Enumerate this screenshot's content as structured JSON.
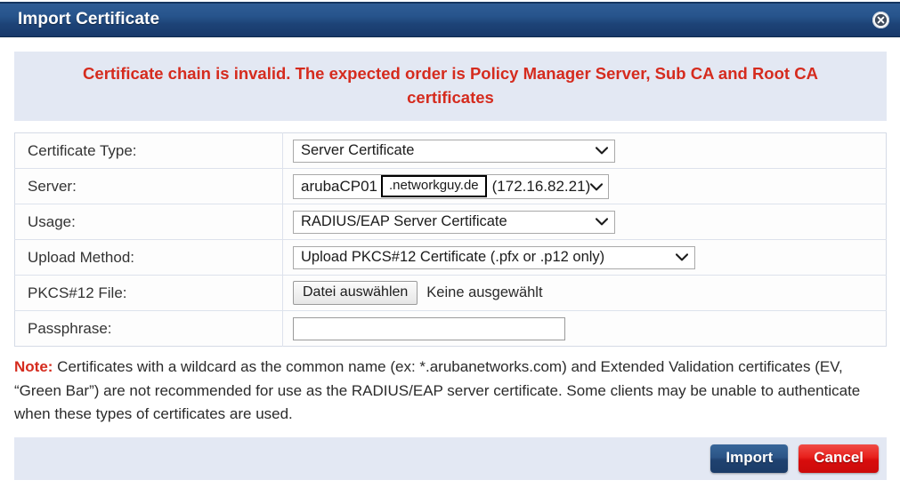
{
  "window": {
    "title": "Import Certificate",
    "close_icon": "close-circle-icon"
  },
  "error": {
    "message": "Certificate chain is invalid. The expected order is Policy Manager Server, Sub CA and Root CA certificates",
    "color": "#d52b1e",
    "background": "#e3e8f3"
  },
  "form": {
    "rows": [
      {
        "label": "Certificate Type:",
        "control": "select",
        "value": "Server Certificate"
      },
      {
        "label": "Server:",
        "control": "server-select",
        "host": "arubaCP01",
        "domain": ".networkguy.de",
        "ip": "(172.16.82.21)"
      },
      {
        "label": "Usage:",
        "control": "select",
        "value": "RADIUS/EAP Server Certificate"
      },
      {
        "label": "Upload Method:",
        "control": "select",
        "value": "Upload PKCS#12 Certificate (.pfx or .p12 only)"
      },
      {
        "label": "PKCS#12 File:",
        "control": "file",
        "button_label": "Datei auswählen",
        "status": "Keine ausgewählt"
      },
      {
        "label": "Passphrase:",
        "control": "text",
        "value": "",
        "placeholder": ""
      }
    ]
  },
  "note": {
    "prefix": "Note:",
    "body": " Certificates with a wildcard as the common name (ex: *.arubanetworks.com) and Extended Validation certificates (EV, “Green Bar”) are not recommended for use as the RADIUS/EAP server certificate. Some clients may be unable to authenticate when these types of certificates are used."
  },
  "footer": {
    "import_label": "Import",
    "cancel_label": "Cancel",
    "import_color": "#23497c",
    "cancel_color": "#e01414"
  }
}
